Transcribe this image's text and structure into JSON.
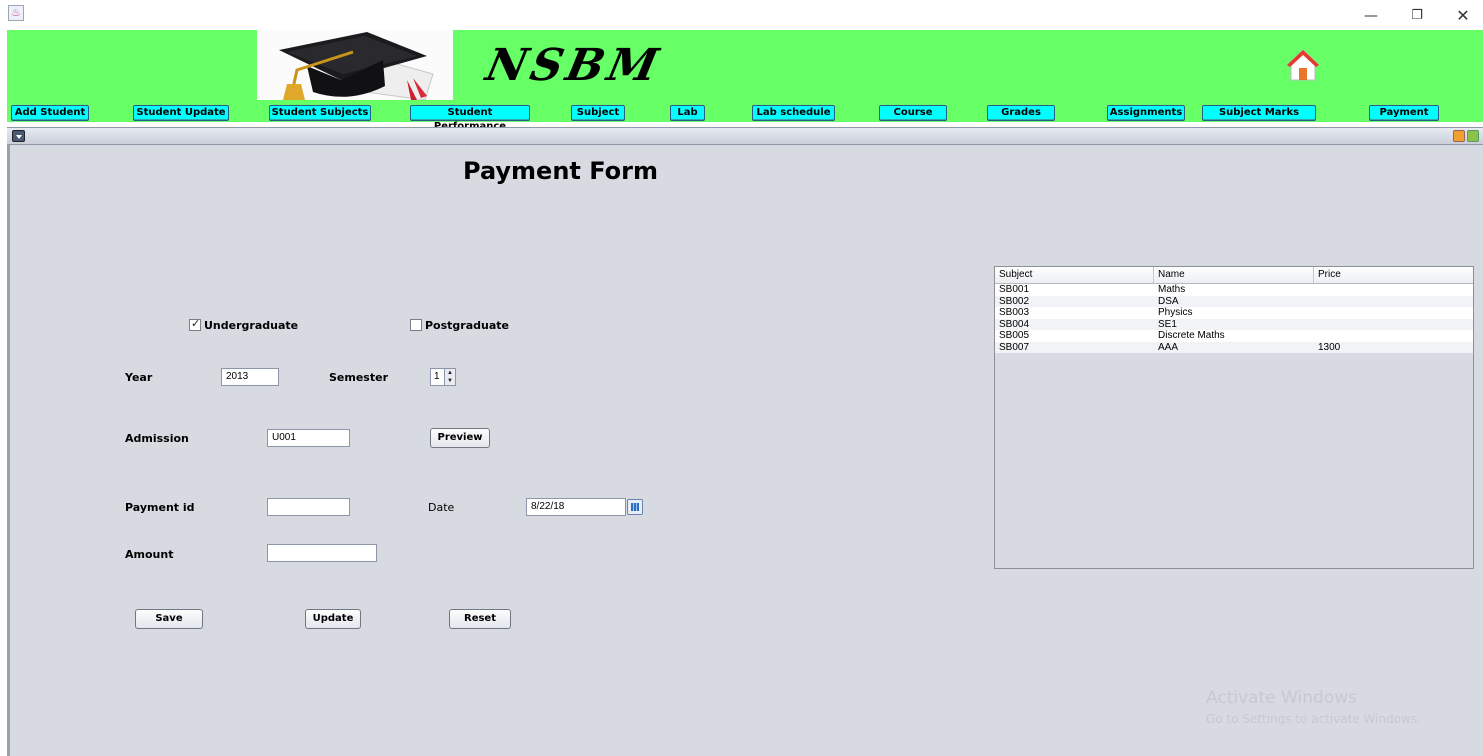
{
  "app": {
    "brand": "NSBM"
  },
  "nav": {
    "buttons": [
      {
        "label": "Add Student"
      },
      {
        "label": "Student Update"
      },
      {
        "label": "Student Subjects"
      },
      {
        "label": "Student Performance"
      },
      {
        "label": "Subject"
      },
      {
        "label": "Lab"
      },
      {
        "label": "Lab schedule"
      },
      {
        "label": "Course"
      },
      {
        "label": "Grades"
      },
      {
        "label": "Assignments"
      },
      {
        "label": "Subject Marks"
      },
      {
        "label": "Payment"
      }
    ]
  },
  "form": {
    "title": "Payment Form",
    "undergraduate": {
      "label": "Undergraduate",
      "checked": true
    },
    "postgraduate": {
      "label": "Postgraduate",
      "checked": false
    },
    "year": {
      "label": "Year",
      "value": "2013"
    },
    "semester": {
      "label": "Semester",
      "value": "1"
    },
    "admission": {
      "label": "Admission",
      "value": "U001"
    },
    "preview_label": "Preview",
    "payment_id": {
      "label": "Payment id",
      "value": ""
    },
    "date": {
      "label": "Date",
      "value": "8/22/18"
    },
    "amount": {
      "label": "Amount",
      "value": ""
    },
    "save_label": "Save",
    "update_label": "Update",
    "reset_label": "Reset"
  },
  "table": {
    "columns": [
      "Subject",
      "Name",
      "Price"
    ],
    "rows": [
      [
        "SB001",
        "Maths",
        ""
      ],
      [
        "SB002",
        "DSA",
        ""
      ],
      [
        "SB003",
        "Physics",
        ""
      ],
      [
        "SB004",
        "SE1",
        ""
      ],
      [
        "SB005",
        "Discrete Maths",
        ""
      ],
      [
        "SB007",
        "AAA",
        "1300"
      ]
    ]
  },
  "watermark": {
    "line1": "Activate Windows",
    "line2": "Go to Settings to activate Windows."
  }
}
